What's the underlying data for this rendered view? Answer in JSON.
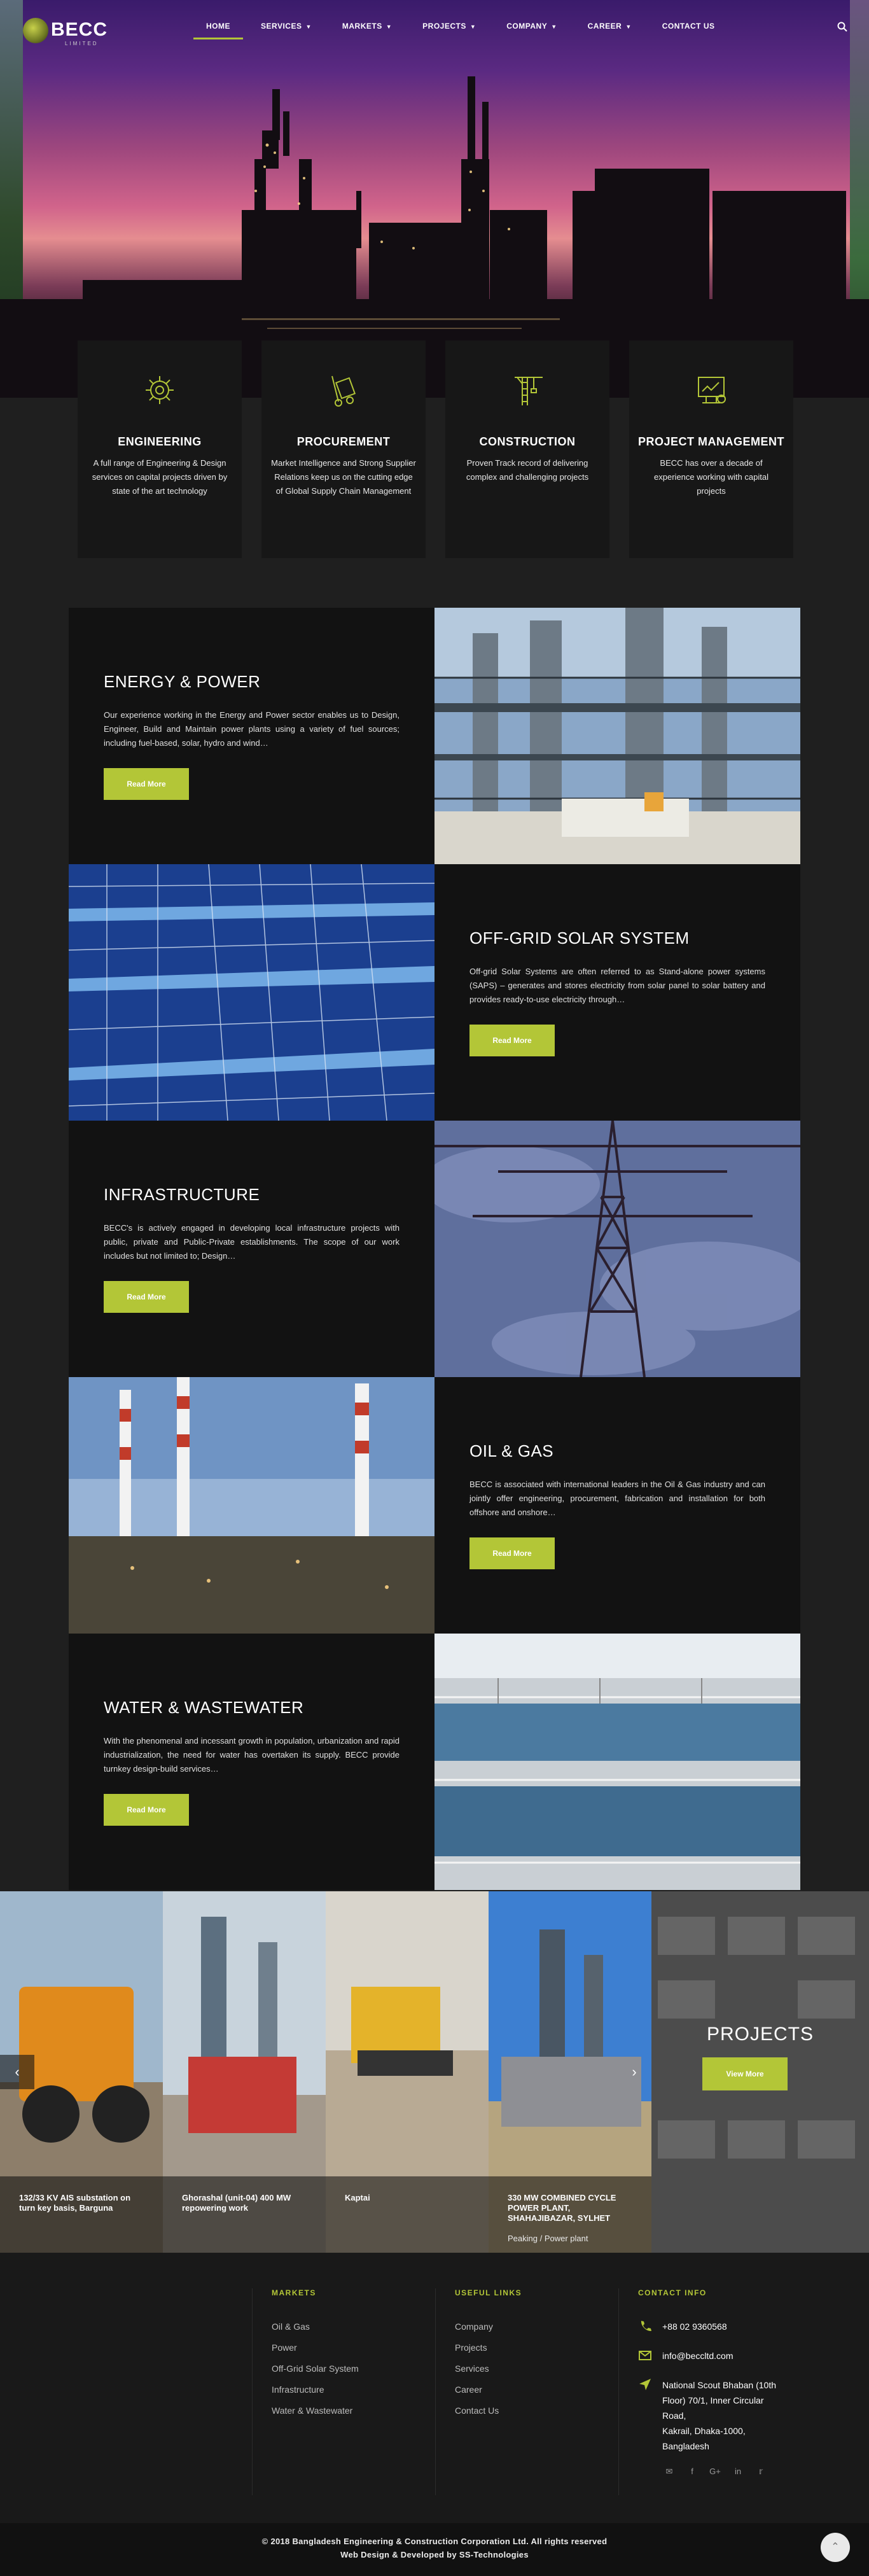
{
  "brand": {
    "name": "BECC",
    "tagline": "LIMITED"
  },
  "nav": {
    "items": [
      {
        "label": "HOME",
        "active": true,
        "has_dropdown": false
      },
      {
        "label": "SERVICES",
        "active": false,
        "has_dropdown": true
      },
      {
        "label": "MARKETS",
        "active": false,
        "has_dropdown": true
      },
      {
        "label": "PROJECTS",
        "active": false,
        "has_dropdown": true
      },
      {
        "label": "COMPANY",
        "active": false,
        "has_dropdown": true
      },
      {
        "label": "CAREER",
        "active": false,
        "has_dropdown": true
      },
      {
        "label": "CONTACT US",
        "active": false,
        "has_dropdown": false
      }
    ],
    "search_icon": "search-icon"
  },
  "services": [
    {
      "icon": "engineering-icon",
      "title": "ENGINEERING",
      "text": "A full range of Engineering & Design services on capital projects driven by state of the art technology"
    },
    {
      "icon": "procurement-icon",
      "title": "PROCUREMENT",
      "text": "Market Intelligence and Strong Supplier Relations keep us on the cutting edge of Global Supply Chain Management"
    },
    {
      "icon": "construction-icon",
      "title": "CONSTRUCTION",
      "text": "Proven Track record of delivering complex and challenging projects"
    },
    {
      "icon": "project-management-icon",
      "title": "PROJECT MANAGEMENT",
      "text": "BECC has over a decade of experience working with capital projects"
    }
  ],
  "markets": [
    {
      "title": "ENERGY & POWER",
      "text": "Our experience working in the Energy and Power sector enables us to Design, Engineer, Build and Maintain power plants using a variety of fuel sources; including fuel-based, solar, hydro and wind…",
      "button": "Read More",
      "image": "power-plant"
    },
    {
      "title": "OFF-GRID SOLAR SYSTEM",
      "text": "Off-grid Solar Systems are often referred to as Stand-alone power systems (SAPS) – generates and stores electricity from solar panel to solar battery and provides ready-to-use electricity through…",
      "button": "Read More",
      "image": "solar-panels"
    },
    {
      "title": "INFRASTRUCTURE",
      "text": "BECC's is actively engaged in developing local infrastructure projects with public, private and Public-Private establishments. The scope of our work includes but not limited to; Design…",
      "button": "Read More",
      "image": "transmission-tower"
    },
    {
      "title": "OIL & GAS",
      "text": "BECC is associated with international leaders in the Oil & Gas industry and can jointly offer engineering, procurement, fabrication and installation for both offshore and onshore…",
      "button": "Read More",
      "image": "refinery"
    },
    {
      "title": "WATER & WASTEWATER",
      "text": "With the phenomenal and incessant growth in population, urbanization and rapid industrialization, the need for water has overtaken its supply. BECC provide turnkey design-build services…",
      "button": "Read More",
      "image": "water-treatment"
    }
  ],
  "projects": {
    "heading": "PROJECTS",
    "button": "View More",
    "items": [
      {
        "title": "132/33 KV AIS substation on turn key basis, Barguna",
        "tags": ""
      },
      {
        "title": "Ghorashal (unit-04) 400 MW repowering work",
        "tags": ""
      },
      {
        "title": "Kaptai",
        "tags": ""
      },
      {
        "title": "330 MW COMBINED CYCLE POWER PLANT, SHAHAJIBAZAR, SYLHET",
        "tags": "Peaking  /  Power plant"
      }
    ]
  },
  "footer": {
    "markets": {
      "heading": "MARKETS",
      "links": [
        "Oil & Gas",
        "Power",
        "Off-Grid Solar System",
        "Infrastructure",
        "Water & Wastewater"
      ]
    },
    "useful_links": {
      "heading": "USEFUL LINKS",
      "links": [
        "Company",
        "Projects",
        "Services",
        "Career",
        "Contact Us"
      ]
    },
    "contact": {
      "heading": "CONTACT INFO",
      "phone": "+88 02 9360568",
      "email": "info@beccltd.com",
      "address": [
        "National Scout Bhaban (10th",
        "Floor) 70/1, Inner Circular",
        "Road,",
        "Kakrail, Dhaka-1000,",
        "Bangladesh"
      ]
    },
    "socials": [
      "email-icon",
      "facebook-icon",
      "google-plus-icon",
      "linkedin-icon",
      "twitter-icon"
    ]
  },
  "copyright": {
    "line1": "© 2018 Bangladesh Engineering & Construction Corporation Ltd. All rights reserved",
    "line2": "Web Design & Developed by SS-Technologies"
  },
  "colors": {
    "accent": "#b3c637",
    "dark": "#121212",
    "bg": "#1f1f1f"
  }
}
